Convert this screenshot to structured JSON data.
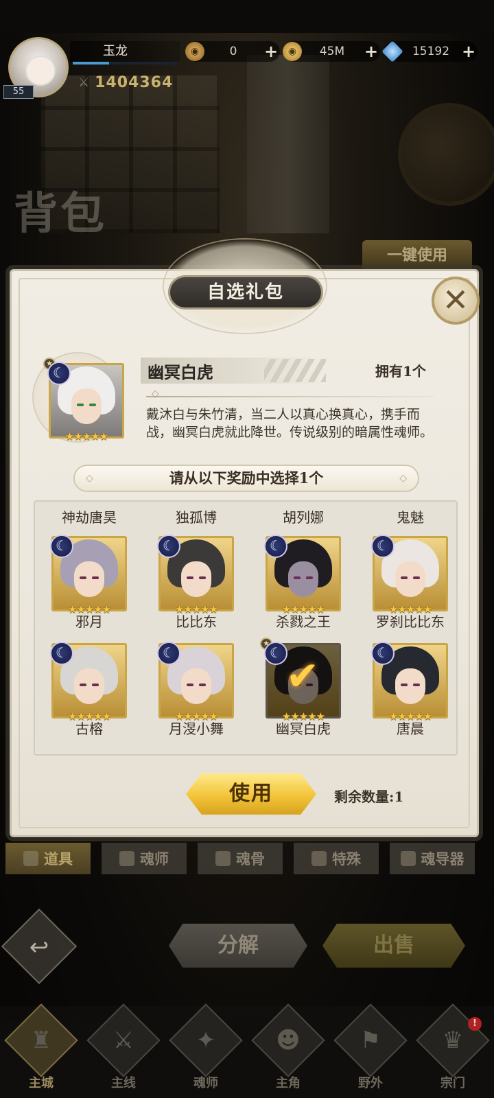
{
  "hud": {
    "player_name": "玉龙",
    "level": "55",
    "exp_fraction": 0.35,
    "power": "1404364",
    "resources": [
      {
        "icon": "coin-bronze-icon",
        "amount": "0"
      },
      {
        "icon": "coin-gold-icon",
        "amount": "45M"
      },
      {
        "icon": "diamond-icon",
        "amount": "15192"
      }
    ]
  },
  "page": {
    "title": "背包",
    "use_all_label": "一键使用"
  },
  "modal": {
    "title": "自选礼包",
    "close_symbol": "✕",
    "item": {
      "name": "幽冥白虎",
      "owned": "拥有1个",
      "description": "戴沐白与朱竹清，当二人以真心换真心，携手而战，幽冥白虎就此降世。传说级别的暗属性魂师。"
    },
    "choose_prompt": "请从以下奖励中选择1个",
    "top_partial_labels": [
      "神劫唐昊",
      "独孤博",
      "胡列娜",
      "鬼魅"
    ],
    "rewards": [
      {
        "name": "邪月",
        "hair": "#a7a0b4",
        "stars": "★★★★★"
      },
      {
        "name": "比比东",
        "hair": "#3c3a38",
        "stars": "★★★★★"
      },
      {
        "name": "杀戮之王",
        "hair": "#1f1c22",
        "stars": "★★★★★",
        "dark": true
      },
      {
        "name": "罗刹比比东",
        "hair": "#ece6e2",
        "stars": "★★★★★"
      },
      {
        "name": "古榕",
        "hair": "#d8d6d2",
        "stars": "★★★★★"
      },
      {
        "name": "月渂小舞",
        "hair": "#d9d3d8",
        "stars": "★★★★★"
      },
      {
        "name": "幽冥白虎",
        "hair": "#2a2826",
        "stars": "★★★★★",
        "selected": true
      },
      {
        "name": "唐晨",
        "hair": "#262a30",
        "stars": "★★★★★"
      }
    ],
    "use_label": "使用",
    "remaining": "剩余数量:1"
  },
  "tabs": [
    {
      "label": "道具",
      "active": true
    },
    {
      "label": "魂师",
      "active": false
    },
    {
      "label": "魂骨",
      "active": false
    },
    {
      "label": "特殊",
      "active": false
    },
    {
      "label": "魂导器",
      "active": false
    }
  ],
  "actions": {
    "back_symbol": "↩",
    "decompose_label": "分解",
    "sell_label": "出售"
  },
  "bottom_nav": [
    {
      "label": "主城",
      "glyph": "♜",
      "active": true
    },
    {
      "label": "主线",
      "glyph": "⚔",
      "active": false
    },
    {
      "label": "魂师",
      "glyph": "✦",
      "active": false
    },
    {
      "label": "主角",
      "glyph": "☻",
      "active": false
    },
    {
      "label": "野外",
      "glyph": "⚑",
      "active": false
    },
    {
      "label": "宗门",
      "glyph": "♛",
      "active": false,
      "badge": "!"
    }
  ]
}
